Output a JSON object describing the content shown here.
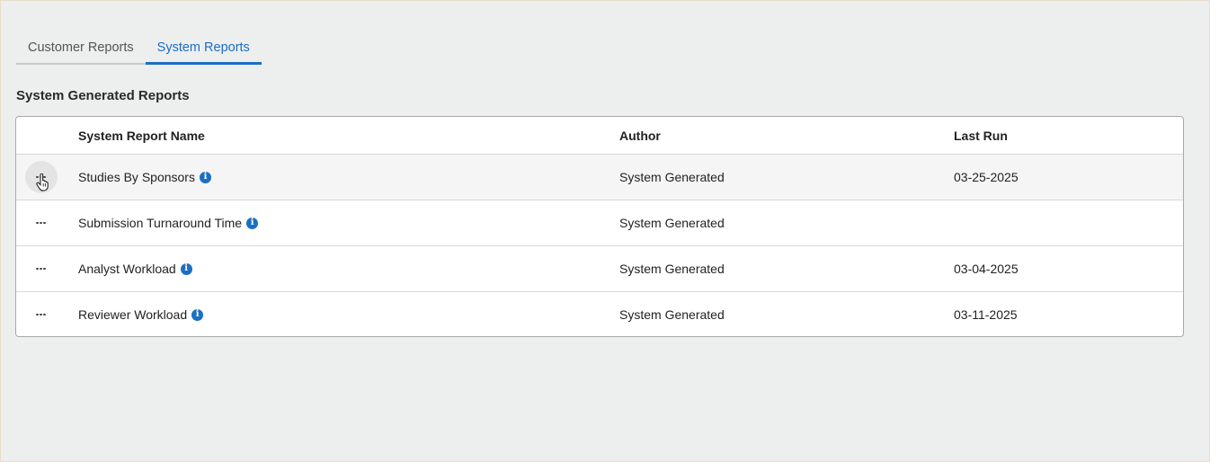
{
  "tabs": [
    {
      "label": "Customer Reports",
      "active": false
    },
    {
      "label": "System Reports",
      "active": true
    }
  ],
  "section_title": "System Generated Reports",
  "table": {
    "headers": {
      "name": "System Report Name",
      "author": "Author",
      "last_run": "Last Run"
    },
    "rows": [
      {
        "name": "Studies By Sponsors",
        "author": "System Generated",
        "last_run": "03-25-2025"
      },
      {
        "name": "Submission Turnaround Time",
        "author": "System Generated",
        "last_run": ""
      },
      {
        "name": "Analyst Workload",
        "author": "System Generated",
        "last_run": "03-04-2025"
      },
      {
        "name": "Reviewer Workload",
        "author": "System Generated",
        "last_run": "03-11-2025"
      }
    ]
  },
  "icons": {
    "info": "info-circle-icon",
    "more": "more-horizontal-icon",
    "cursor": "hand-pointer-icon"
  },
  "colors": {
    "accent": "#1a6fc4",
    "background": "#edeeee"
  }
}
